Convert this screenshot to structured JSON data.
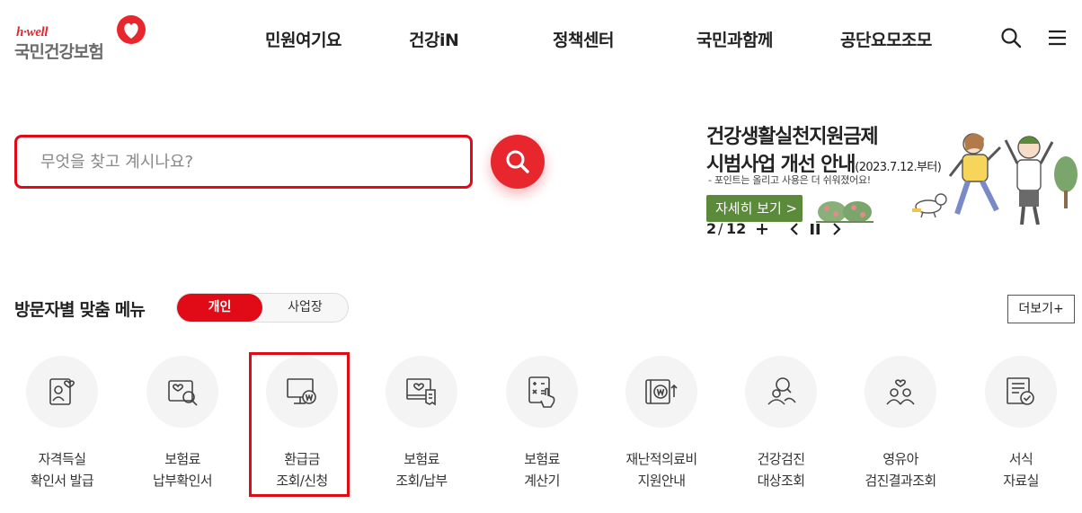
{
  "logo": {
    "sub": "h·well",
    "main": "국민건강보험"
  },
  "nav": [
    "민원여기요",
    "건강iN",
    "정책센터",
    "국민과함께",
    "공단요모조모"
  ],
  "header_icons": [
    "search-icon",
    "hamburger-menu-icon"
  ],
  "search": {
    "placeholder": "무엇을 찾고 계시나요?"
  },
  "banner": {
    "title1": "건강생활실천지원금제",
    "title2": "시범사업 개선 안내",
    "title2_date": "(2023.7.12.부터)",
    "note": "- 포인트는 올리고 사용은 더 쉬워졌어요!",
    "more_label": "자세히 보기 >",
    "page_current": "2",
    "page_sep": "/",
    "page_total": "12"
  },
  "menu_section": {
    "title": "방문자별 맞춤 메뉴",
    "tab_on": "개인",
    "tab_off": "사업장",
    "more_label": "더보기+",
    "items": [
      {
        "line1": "자격득실",
        "line2": "확인서 발급",
        "icon": "id-card-heart-icon"
      },
      {
        "line1": "보험료",
        "line2": "납부확인서",
        "icon": "document-search-icon"
      },
      {
        "line1": "환급금",
        "line2": "조회/신청",
        "icon": "monitor-won-icon"
      },
      {
        "line1": "보험료",
        "line2": "조회/납부",
        "icon": "receipt-heart-icon"
      },
      {
        "line1": "보험료",
        "line2": "계산기",
        "icon": "calculator-hand-icon"
      },
      {
        "line1": "재난적의료비",
        "line2": "지원안내",
        "icon": "wallet-won-icon"
      },
      {
        "line1": "건강검진",
        "line2": "대상조회",
        "icon": "person-search-icon"
      },
      {
        "line1": "영유아",
        "line2": "검진결과조회",
        "icon": "family-heart-icon"
      },
      {
        "line1": "서식",
        "line2": "자료실",
        "icon": "form-check-icon"
      }
    ],
    "highlighted_item": "환급금 조회/신청"
  },
  "colors": {
    "brand_red": "#e10a17",
    "banner_green": "#5a8a3a",
    "circle_bg": "#f4f4f4"
  }
}
